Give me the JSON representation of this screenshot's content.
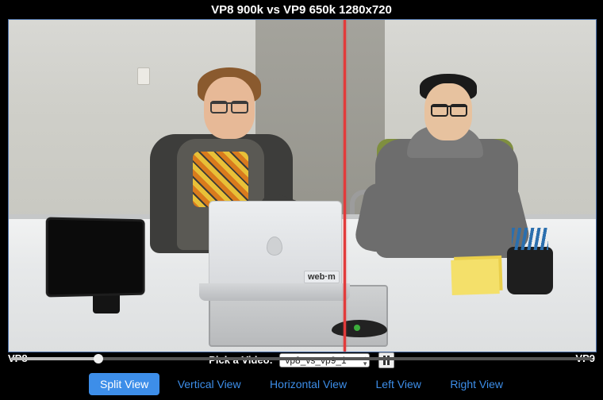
{
  "title": "VP8 900k vs VP9 650k 1280x720",
  "left_codec": "VP8",
  "right_codec": "VP9",
  "laptop_sticker": "web·m",
  "picker": {
    "label": "Pick a Video:",
    "selected": "vp8_vs_vp9_1",
    "options": [
      "vp8_vs_vp9_1"
    ]
  },
  "playback": {
    "state": "playing",
    "progress_pct": 15
  },
  "views": {
    "items": [
      "Split View",
      "Vertical View",
      "Horizontal View",
      "Left View",
      "Right View"
    ],
    "active_index": 0
  },
  "divider_pct": 57,
  "colors": {
    "accent": "#3d8ee9",
    "divider": "#e23b3b"
  }
}
